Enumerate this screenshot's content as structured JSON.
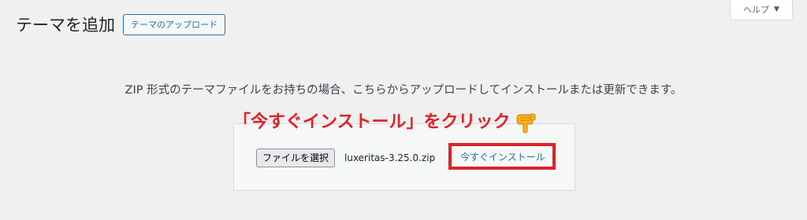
{
  "header": {
    "page_title": "テーマを追加",
    "upload_button_label": "テーマのアップロード",
    "help_label": "ヘルプ",
    "help_caret": "▼"
  },
  "upload": {
    "description": "ZIP 形式のテーマファイルをお持ちの場合、こちらからアップロードしてインストールまたは更新できます。",
    "file_button_label": "ファイルを選択",
    "selected_file": "luxeritas-3.25.0.zip",
    "install_button_label": "今すぐインストール"
  },
  "annotation": {
    "callout_text": "「今すぐインストール」をクリック",
    "highlight_color": "#e0212a",
    "pointer_icon": "backhand-index-pointing-down-icon"
  },
  "colors": {
    "background": "#f0f0f1",
    "accent": "#2271b1",
    "annotation_red": "#e0212a"
  }
}
